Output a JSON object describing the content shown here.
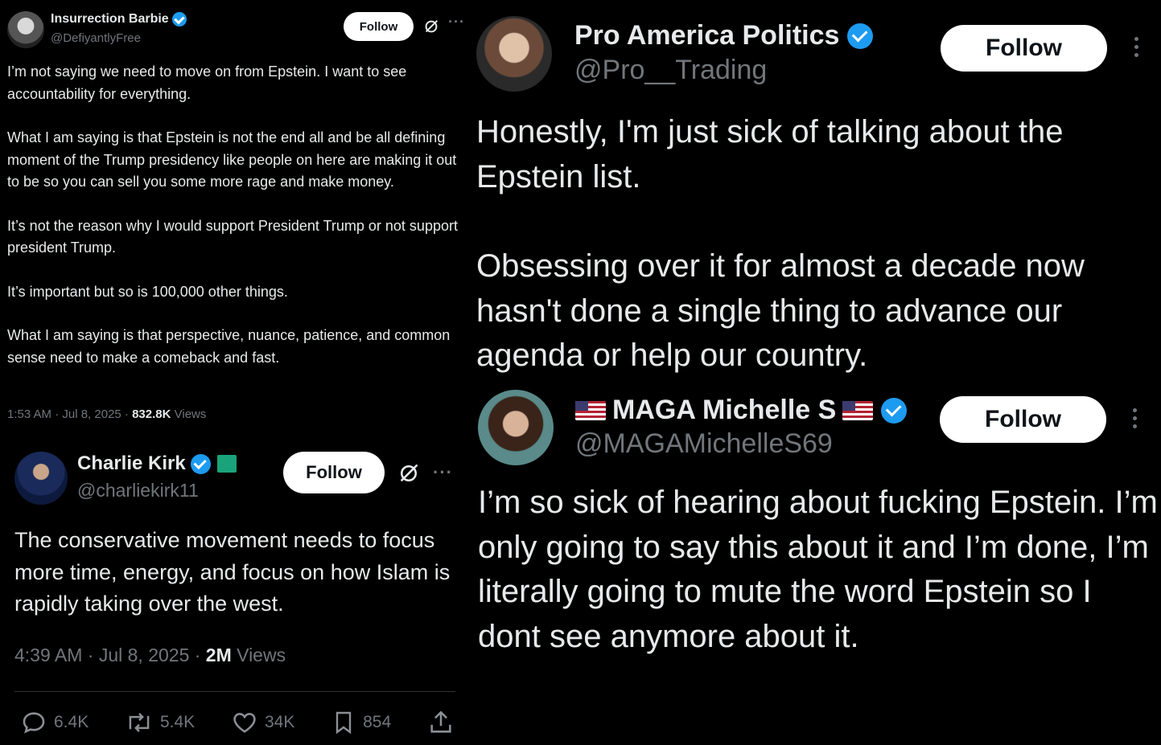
{
  "tweet1": {
    "name": "Insurrection Barbie",
    "handle": "@DefiyantlyFree",
    "follow": "Follow",
    "paragraphs": [
      "I’m not saying we need to move on from Epstein. I want to see accountability for everything.",
      "What I am saying is that Epstein is not the end all and be all defining moment of the Trump presidency like people on here are making it out to be so you can sell you some more rage and make money.",
      "It’s not the reason why I would support President Trump or not support president Trump.",
      "It’s important but so is 100,000 other things.",
      "What I am saying is that perspective, nuance, patience, and common sense need to make a  comeback and fast."
    ],
    "time": "1:53 AM · Jul 8, 2025 · ",
    "views_count": "832.8K",
    "views_label": " Views"
  },
  "tweet2": {
    "name": "Charlie Kirk",
    "handle": "@charliekirk11",
    "follow": "Follow",
    "text": "The conservative movement needs to focus more time, energy, and focus on how Islam is rapidly taking over the west.",
    "time": "4:39 AM · Jul 8, 2025 · ",
    "views_count": "2M",
    "views_label": " Views",
    "replies": "6.4K",
    "reposts": "5.4K",
    "likes": "34K",
    "bookmarks": "854"
  },
  "tweet3": {
    "name": "Pro America Politics",
    "handle": "@Pro__Trading",
    "follow": "Follow",
    "paragraphs": [
      "Honestly, I'm just sick of talking about the Epstein list.",
      "Obsessing over it for almost a decade now hasn't done a single thing to advance our agenda or help our country."
    ]
  },
  "tweet4": {
    "name": "MAGA Michelle S",
    "handle": "@MAGAMichelleS69",
    "follow": "Follow",
    "text": "I’m so sick of hearing about fucking Epstein.  I’m only going to say this about it and I’m done, I’m literally going to mute the word Epstein so I dont see anymore about it."
  },
  "colors": {
    "background": "#000000",
    "text": "#e7e9ea",
    "secondary_text": "#71767b",
    "verified": "#1d9bf0",
    "button_bg": "#ffffff"
  },
  "icons": [
    "verified-badge-icon",
    "grok-icon",
    "more-icon",
    "reply-icon",
    "repost-icon",
    "like-icon",
    "bookmark-icon",
    "share-icon",
    "us-flag-icon"
  ]
}
